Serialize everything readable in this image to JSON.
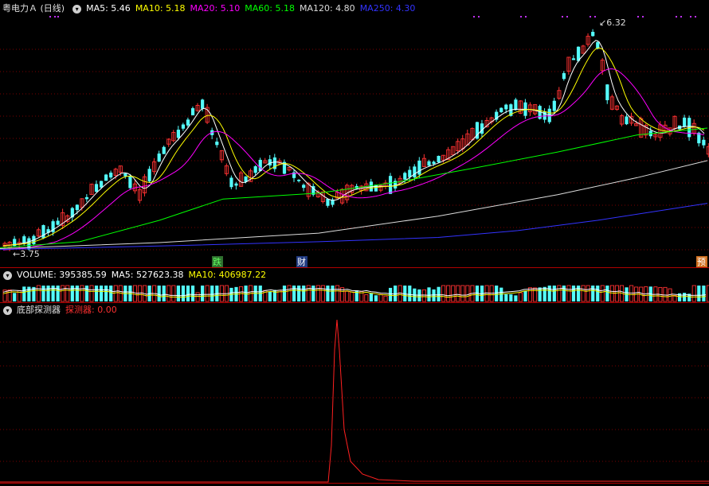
{
  "main": {
    "title": "粤电力Ａ (日线)",
    "ma": [
      {
        "label": "MA5: 5.46",
        "color": "#ffffff"
      },
      {
        "label": "MA10: 5.18",
        "color": "#ffff00"
      },
      {
        "label": "MA20: 5.10",
        "color": "#ff00ff"
      },
      {
        "label": "MA60: 5.18",
        "color": "#00ff00"
      },
      {
        "label": "MA120: 4.80",
        "color": "#dcdcdc"
      },
      {
        "label": "MA250: 4.30",
        "color": "#3333ff"
      }
    ],
    "high_label": "6.32",
    "low_label": "3.75",
    "markers": [
      "跌",
      "财",
      "预"
    ]
  },
  "volume": {
    "labels": [
      {
        "label": "VOLUME: 395385.59",
        "color": "#ffffff"
      },
      {
        "label": "MA5: 527623.38",
        "color": "#ffffff"
      },
      {
        "label": "MA10: 406987.22",
        "color": "#ffff00"
      }
    ]
  },
  "indicator": {
    "title": "底部探测器",
    "value_label": "探测器: 0.00"
  },
  "colors": {
    "up": "#ff3232",
    "down": "#54fcfc",
    "grid": "#7a0000",
    "signal": "#ff2020"
  }
}
